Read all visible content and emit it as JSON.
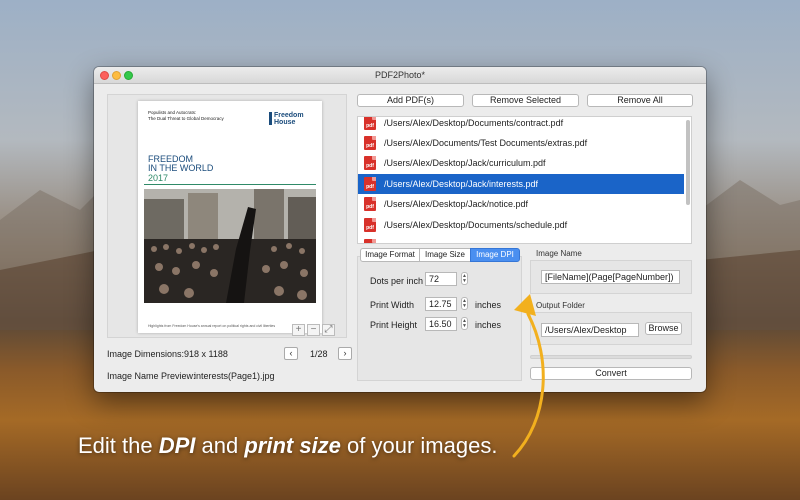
{
  "window": {
    "title": "PDF2Photo*"
  },
  "preview": {
    "doc_header": "Populists and Autocrats:",
    "doc_subheader": "The Dual Threat to Global Democracy",
    "logo_line1": "Freedom",
    "logo_line2": "House",
    "doc_title_line1": "FREEDOM",
    "doc_title_line2": "IN THE WORLD",
    "doc_year": "2017",
    "doc_footer": "Highlights from Freedom House's annual report on political rights and civil liberties",
    "zoom_in": "+",
    "zoom_out": "−",
    "fit": "⤢"
  },
  "info": {
    "dimensions_label": "Image Dimensions:",
    "dimensions_value": "918 x 1188",
    "page_indicator": "1/28",
    "prev": "‹",
    "next": "›",
    "name_preview_label": "Image Name Preview:",
    "name_preview_value": "interests(Page1).jpg"
  },
  "toolbar": {
    "add_label": "Add PDF(s)",
    "remove_selected_label": "Remove Selected",
    "remove_all_label": "Remove All"
  },
  "files": [
    {
      "icon": "pdf",
      "path": "/Users/Alex/Desktop/Documents/contract.pdf",
      "selected": false
    },
    {
      "icon": "pdf",
      "path": "/Users/Alex/Documents/Test Documents/extras.pdf",
      "selected": false
    },
    {
      "icon": "pdf",
      "path": "/Users/Alex/Desktop/Jack/curriculum.pdf",
      "selected": false
    },
    {
      "icon": "pdf",
      "path": "/Users/Alex/Desktop/Jack/interests.pdf",
      "selected": true
    },
    {
      "icon": "pdf",
      "path": "/Users/Alex/Desktop/Jack/notice.pdf",
      "selected": false
    },
    {
      "icon": "pdf",
      "path": "/Users/Alex/Desktop/Documents/schedule.pdf",
      "selected": false
    },
    {
      "icon": "pdf",
      "path": "",
      "selected": false
    }
  ],
  "tabs": [
    {
      "label": "Image Format",
      "active": false
    },
    {
      "label": "Image Size",
      "active": false
    },
    {
      "label": "Image DPI",
      "active": true
    }
  ],
  "dpi": {
    "dots_label": "Dots per inch",
    "dots_value": "72",
    "width_label": "Print Width",
    "width_value": "12.75",
    "width_unit": "inches",
    "height_label": "Print Height",
    "height_value": "16.50",
    "height_unit": "inches"
  },
  "image_name": {
    "label": "Image Name",
    "value": "[FileName](Page[PageNumber])"
  },
  "output": {
    "label": "Output Folder",
    "value": "/Users/Alex/Desktop",
    "browse_label": "Browse"
  },
  "convert": {
    "label": "Convert",
    "progress": 0
  },
  "caption": {
    "part1": "Edit the ",
    "em1": "DPI",
    "part2": " and ",
    "em2": "print size",
    "part3": " of your images."
  },
  "colors": {
    "selection": "#1a64c8",
    "active_tab": "#4a8ff0",
    "arrow": "#f2b01e",
    "pdf_icon": "#d8312a"
  }
}
